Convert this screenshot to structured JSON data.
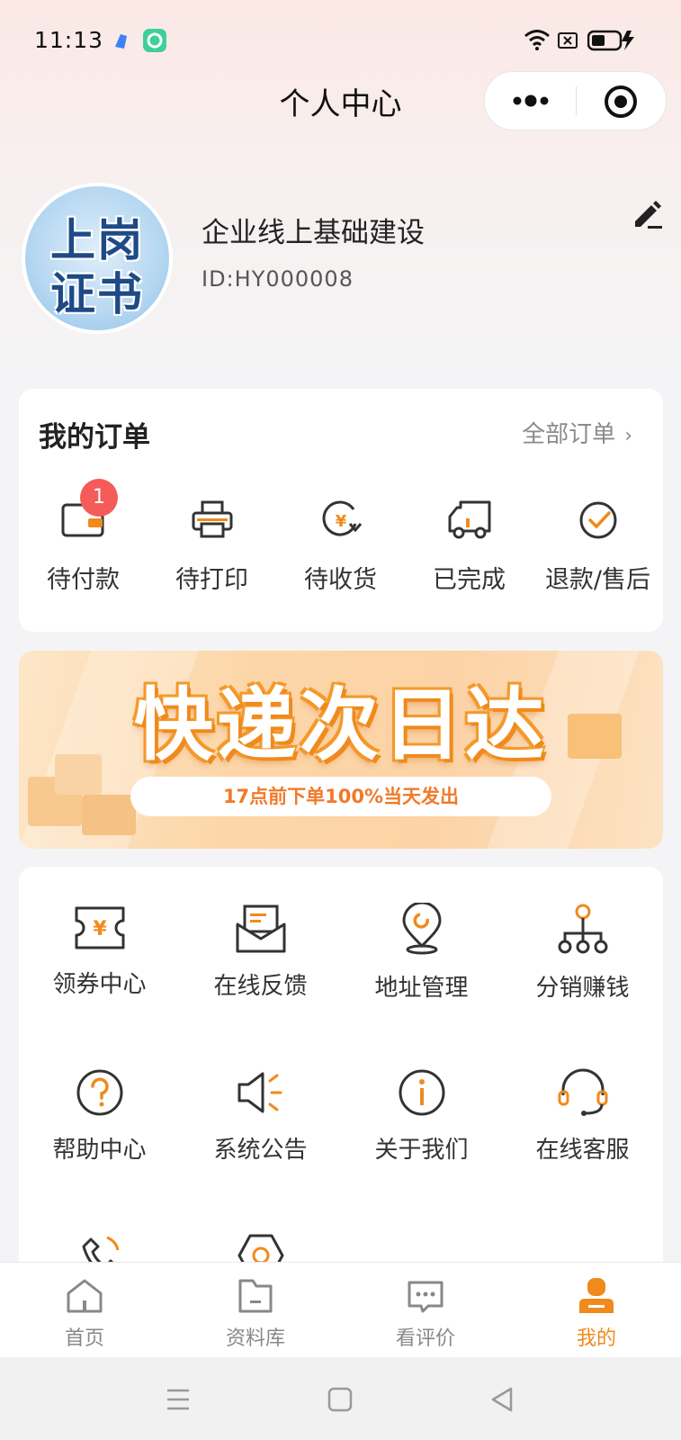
{
  "status_bar": {
    "time": "11:13",
    "icons": [
      "app-icon-blue",
      "app-icon-green",
      "wifi-icon",
      "sim-icon",
      "battery-icon"
    ]
  },
  "header": {
    "title": "个人中心",
    "capsule_icons": [
      "more-icon",
      "close-icon"
    ]
  },
  "profile": {
    "avatar_text_line1": "上岗",
    "avatar_text_line2": "证书",
    "name": "企业线上基础建设",
    "id": "ID:HY000008",
    "edit_icon": "edit-icon"
  },
  "orders": {
    "title": "我的订单",
    "all_label": "全部订单",
    "items": [
      {
        "label": "待付款",
        "icon": "wallet-icon",
        "badge": "1"
      },
      {
        "label": "待打印",
        "icon": "printer-icon"
      },
      {
        "label": "待收货",
        "icon": "receive-icon"
      },
      {
        "label": "已完成",
        "icon": "truck-icon"
      },
      {
        "label": "退款/售后",
        "icon": "check-circle-icon"
      }
    ]
  },
  "banner": {
    "headline": "快递次日达",
    "subline": "17点前下单100%当天发出"
  },
  "services": {
    "items": [
      {
        "label": "领券中心",
        "icon": "coupon-icon"
      },
      {
        "label": "在线反馈",
        "icon": "mail-icon"
      },
      {
        "label": "地址管理",
        "icon": "location-icon"
      },
      {
        "label": "分销赚钱",
        "icon": "distribution-icon"
      },
      {
        "label": "帮助中心",
        "icon": "help-icon"
      },
      {
        "label": "系统公告",
        "icon": "speaker-icon"
      },
      {
        "label": "关于我们",
        "icon": "info-icon"
      },
      {
        "label": "在线客服",
        "icon": "headset-icon"
      }
    ]
  },
  "tabbar": {
    "items": [
      {
        "label": "首页",
        "icon": "home-icon",
        "active": false
      },
      {
        "label": "资料库",
        "icon": "folder-icon",
        "active": false
      },
      {
        "label": "看评价",
        "icon": "comment-icon",
        "active": false
      },
      {
        "label": "我的",
        "icon": "user-icon",
        "active": true
      }
    ]
  },
  "colors": {
    "accent": "#f08a1c",
    "badge": "#f45b59",
    "icon_stroke": "#333333"
  }
}
